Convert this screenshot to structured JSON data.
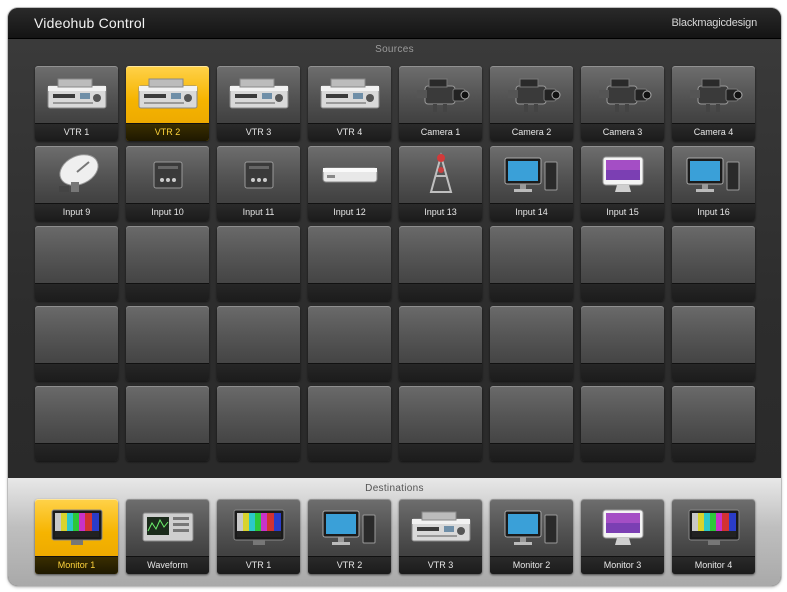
{
  "app": {
    "title": "Videohub Control",
    "brand": "Blackmagicdesign"
  },
  "sources": {
    "label": "Sources",
    "selected_index": 1,
    "items": [
      {
        "label": "VTR 1",
        "icon": "vtr-deck-icon"
      },
      {
        "label": "VTR 2",
        "icon": "vtr-deck-icon"
      },
      {
        "label": "VTR 3",
        "icon": "vtr-deck-icon"
      },
      {
        "label": "VTR 4",
        "icon": "vtr-deck-icon"
      },
      {
        "label": "Camera 1",
        "icon": "camera-icon"
      },
      {
        "label": "Camera 2",
        "icon": "camera-icon"
      },
      {
        "label": "Camera 3",
        "icon": "camera-icon"
      },
      {
        "label": "Camera 4",
        "icon": "camera-icon"
      },
      {
        "label": "Input 9",
        "icon": "satellite-dish-icon"
      },
      {
        "label": "Input 10",
        "icon": "converter-box-icon"
      },
      {
        "label": "Input 11",
        "icon": "converter-box-icon"
      },
      {
        "label": "Input 12",
        "icon": "rack-unit-icon"
      },
      {
        "label": "Input 13",
        "icon": "transmitter-tower-icon"
      },
      {
        "label": "Input 14",
        "icon": "monitor-computer-icon"
      },
      {
        "label": "Input 15",
        "icon": "imac-computer-icon"
      },
      {
        "label": "Input 16",
        "icon": "monitor-computer-icon"
      }
    ],
    "empty_count": 24,
    "pages": 2,
    "current_page": 0
  },
  "destinations": {
    "label": "Destinations",
    "selected_index": 0,
    "items": [
      {
        "label": "Monitor 1",
        "icon": "color-bars-monitor-icon"
      },
      {
        "label": "Waveform",
        "icon": "waveform-monitor-icon"
      },
      {
        "label": "VTR 1",
        "icon": "color-bars-monitor-icon"
      },
      {
        "label": "VTR 2",
        "icon": "monitor-computer-icon"
      },
      {
        "label": "VTR 3",
        "icon": "vtr-deck-icon"
      },
      {
        "label": "Monitor 2",
        "icon": "monitor-computer-icon"
      },
      {
        "label": "Monitor 3",
        "icon": "imac-computer-icon"
      },
      {
        "label": "Monitor 4",
        "icon": "color-bars-monitor-icon"
      }
    ],
    "pages": 3,
    "current_page": 0
  },
  "colors": {
    "selected": "#f6b400",
    "panel": "#2f2f2f",
    "dest_panel": "#bfbfbf"
  }
}
